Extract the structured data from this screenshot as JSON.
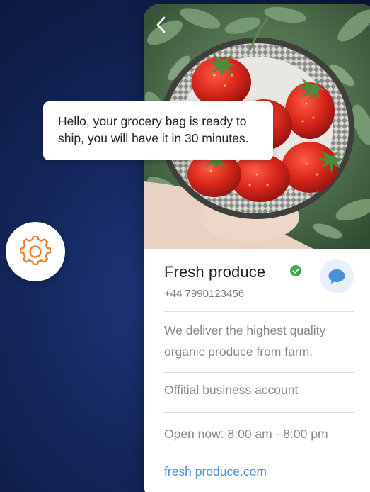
{
  "message": {
    "text": "Hello, your grocery bag is ready to ship, you will have it in 30 minutes."
  },
  "settings": {
    "icon": "gear-icon",
    "accent_color": "#f07b2a"
  },
  "hero": {
    "image": "bowl-of-strawberries-photo",
    "back_icon": "chevron-left-icon"
  },
  "business": {
    "name": "Fresh produce",
    "verified_icon": "verified-check-icon",
    "verified_color": "#3daa4d",
    "phone": "+44 7990123456",
    "chat_icon": "chat-bubble-icon",
    "chat_color": "#4a90d9",
    "description": "We deliver the highest quality organic produce from farm.",
    "account_type": "Offitial business account",
    "hours": "Open now: 8:00 am - 8:00 pm",
    "website": "fresh produce.com"
  }
}
